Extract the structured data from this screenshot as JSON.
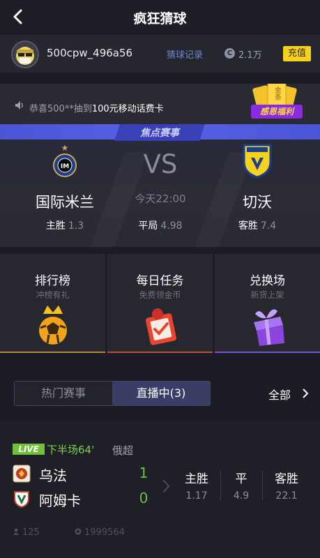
{
  "header": {
    "title": "疯狂猜球",
    "back_icon": "back-arrow-icon"
  },
  "user": {
    "name": "500cpw_496a56",
    "record_label": "猜球记录",
    "coin_symbol": "C",
    "coins": "2.1万",
    "recharge_label": "充值"
  },
  "notice": {
    "text_prefix": "恭喜500**抽到",
    "text_highlight": "100元移动话费卡",
    "promo_label": "感恩福利",
    "promo_icon_text": "金条"
  },
  "featured": {
    "badge": "焦点赛事",
    "home": {
      "name": "国际米兰",
      "odds_label": "主胜",
      "odds": "1.3"
    },
    "away": {
      "name": "切沃",
      "odds_label": "客胜",
      "odds": "7.4"
    },
    "vs": "VS",
    "time": "今天22:00",
    "draw": {
      "odds_label": "平局",
      "odds": "4.98"
    }
  },
  "features": [
    {
      "title": "排行榜",
      "subtitle": "冲榜有礼",
      "icon": "trophy-ball-icon"
    },
    {
      "title": "每日任务",
      "subtitle": "免费领金币",
      "icon": "clipboard-task-icon"
    },
    {
      "title": "兑换场",
      "subtitle": "新货上架",
      "icon": "gift-box-icon"
    }
  ],
  "tabs": {
    "hot": "热门赛事",
    "live": "直播中(3)",
    "all": "全部"
  },
  "live_match": {
    "live_tag": "LIVE",
    "period": "下半场64'",
    "league": "俄超",
    "home": {
      "name": "乌法",
      "score": "1"
    },
    "away": {
      "name": "阿姆卡",
      "score": "0"
    },
    "odds": [
      {
        "label": "主胜",
        "value": "1.17"
      },
      {
        "label": "平",
        "value": "4.9"
      },
      {
        "label": "客胜",
        "value": "22.1"
      }
    ],
    "participants": "125",
    "pool": "1999564"
  },
  "colors": {
    "accent_blue": "#4b55d6",
    "live_green": "#6fc03a",
    "recharge_yellow": "#f5d21d",
    "promo_purple": "#8a2be2"
  }
}
